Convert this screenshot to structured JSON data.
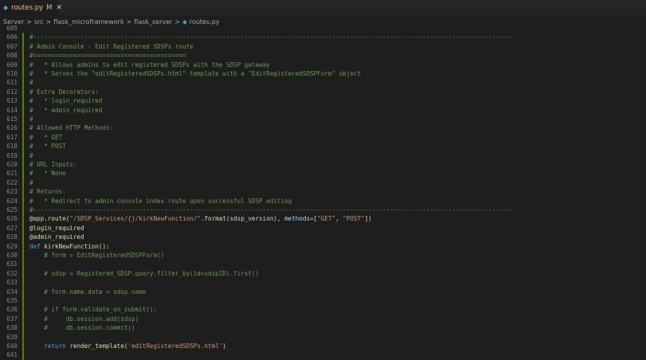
{
  "tab": {
    "filename": "routes.py",
    "modified": "M",
    "close": "✕"
  },
  "breadcrumb": [
    "Server",
    "src",
    "flask_microframework",
    "flask_server",
    "routes.py"
  ],
  "lines": [
    {
      "n": "605",
      "t": ""
    },
    {
      "n": "606",
      "t": "#------------------------------------------------------------------------------------------------------------------------------------"
    },
    {
      "n": "607",
      "t": "# Admin Console - Edit Registered SDSPs route"
    },
    {
      "n": "608",
      "t": "#=========================================="
    },
    {
      "n": "609",
      "t": "#   * Allows admins to edit registered SDSPs with the SDSP gateway"
    },
    {
      "n": "610",
      "t": "#   * Serves the \"editRegisteredSDSPs.html\" template with a \"EditRegisteredSDSPForm\" object"
    },
    {
      "n": "611",
      "t": "#"
    },
    {
      "n": "612",
      "t": "# Extra Decorators:"
    },
    {
      "n": "613",
      "t": "#   * login_required"
    },
    {
      "n": "614",
      "t": "#   * admin_required"
    },
    {
      "n": "615",
      "t": "#"
    },
    {
      "n": "616",
      "t": "# Allowed HTTP Methods:"
    },
    {
      "n": "617",
      "t": "#   * GET"
    },
    {
      "n": "618",
      "t": "#   * POST"
    },
    {
      "n": "619",
      "t": "#"
    },
    {
      "n": "620",
      "t": "# URL Inputs:"
    },
    {
      "n": "621",
      "t": "#   * None"
    },
    {
      "n": "622",
      "t": "#"
    },
    {
      "n": "623",
      "t": "# Returns:"
    },
    {
      "n": "624",
      "t": "#   * Redirect to admin console index route upon successful SDSP editing"
    },
    {
      "n": "625",
      "t": "#------------------------------------------------------------------------------------------------------------------------------------"
    },
    {
      "n": "626",
      "t": "@app.route(\"/SDSP_Services/{}/kirkNewFunction/\".format(sdsp_version), methods=[\"GET\", \"POST\"])"
    },
    {
      "n": "627",
      "t": "@login_required"
    },
    {
      "n": "628",
      "t": "@admin_required"
    },
    {
      "n": "629",
      "t": "def kirkNewFunction():"
    },
    {
      "n": "630",
      "t": "    # form = EditRegisteredSDSPForm()"
    },
    {
      "n": "631",
      "t": ""
    },
    {
      "n": "632",
      "t": "    # sdsp = Registered_SDSP.query.filter_by(id=sdspID).first()"
    },
    {
      "n": "633",
      "t": ""
    },
    {
      "n": "634",
      "t": "    # form.name.data = sdsp.name"
    },
    {
      "n": "635",
      "t": ""
    },
    {
      "n": "636",
      "t": "    # if form.validate_on_submit():"
    },
    {
      "n": "637",
      "t": "    #     db.session.add(sdsp)"
    },
    {
      "n": "638",
      "t": "    #     db.session.commit()"
    },
    {
      "n": "639",
      "t": ""
    },
    {
      "n": "640",
      "t": "    return render_template('editRegisteredSDSPs.html')"
    },
    {
      "n": "641",
      "t": ""
    }
  ],
  "colors": {
    "comment": "#6a9955",
    "keyword": "#569cd6",
    "function": "#dcdcaa",
    "string": "#ce9178",
    "gutter_modified": "#587c0c"
  }
}
